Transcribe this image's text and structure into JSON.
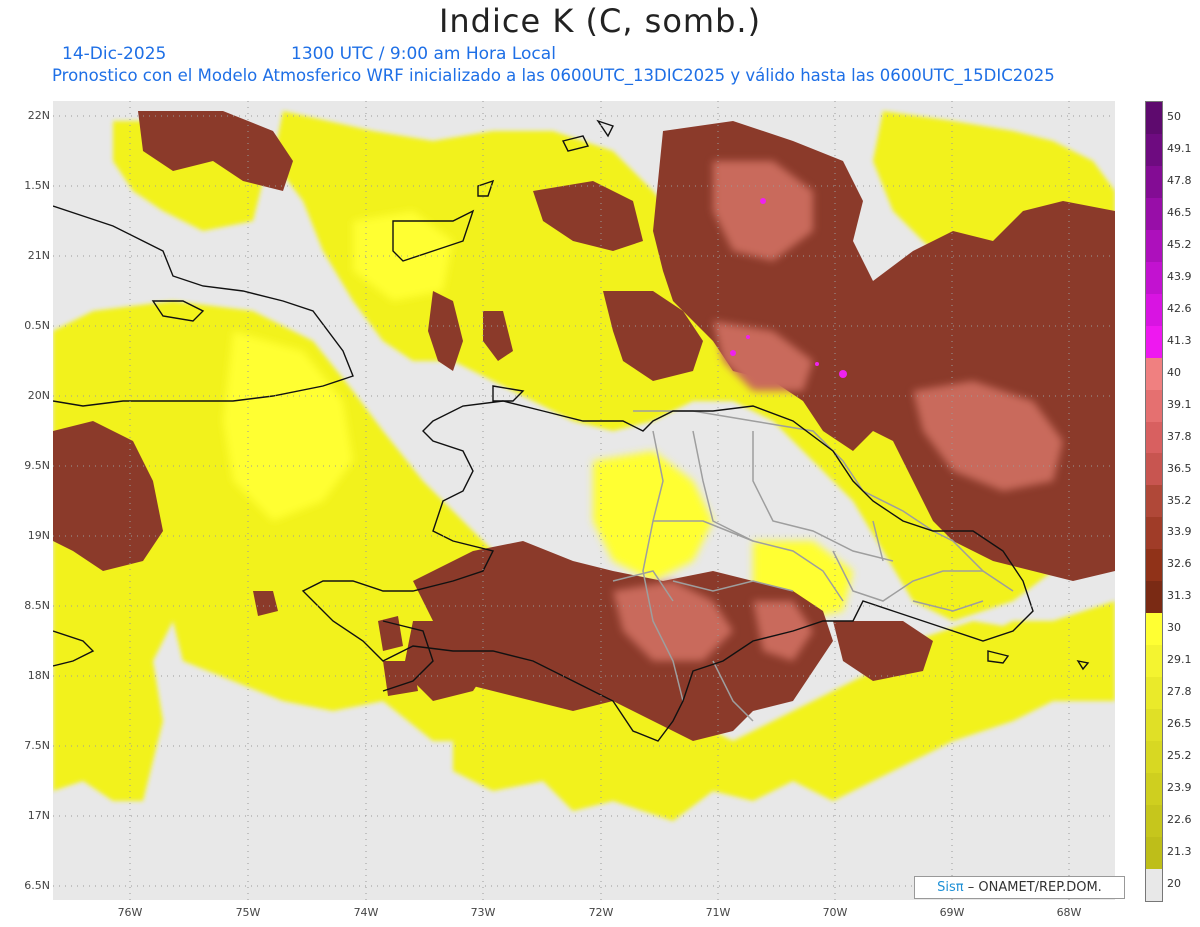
{
  "header": {
    "title": "Indice K (C, somb.)",
    "date": "14-Dic-2025",
    "time": "1300 UTC / 9:00 am Hora Local",
    "model_info": "Pronostico con el Modelo Atmosferico WRF inicializado a las 0600UTC_13DIC2025 y válido hasta las  0600UTC_15DIC2025"
  },
  "axes": {
    "lat_labels": [
      "22N",
      "1.5N",
      "21N",
      "0.5N",
      "20N",
      "9.5N",
      "19N",
      "8.5N",
      "18N",
      "7.5N",
      "17N",
      "6.5N"
    ],
    "lon_labels": [
      "76W",
      "75W",
      "74W",
      "73W",
      "72W",
      "71W",
      "70W",
      "69W",
      "68W"
    ]
  },
  "colorbar": {
    "labels": [
      "50",
      "49.1",
      "47.8",
      "46.5",
      "45.2",
      "43.9",
      "42.6",
      "41.3",
      "40",
      "39.1",
      "37.8",
      "36.5",
      "35.2",
      "33.9",
      "32.6",
      "31.3",
      "30",
      "29.1",
      "27.8",
      "26.5",
      "25.2",
      "23.9",
      "22.6",
      "21.3",
      "20"
    ],
    "colors": [
      "#5e0a6e",
      "#6e0b80",
      "#830c94",
      "#980ea8",
      "#ad10bc",
      "#c212d0",
      "#d814e2",
      "#ee18f0",
      "#f08080",
      "#e57070",
      "#d86060",
      "#c85550",
      "#b04838",
      "#a03c28",
      "#903218",
      "#7a2a14",
      "#ffff33",
      "#f4f430",
      "#eaea2a",
      "#e0e026",
      "#d8d822",
      "#cfcf1f",
      "#c6c61c",
      "#bebe19",
      "#e8e8e8"
    ]
  },
  "legend_colors": {
    "background": "#e8e8e8",
    "low_yellow": "#f2f21e",
    "bright_yellow": "#ffff33",
    "brown": "#8b3a2a",
    "rose": "#c96a5c",
    "magenta": "#ee22ee",
    "coast": "#111111",
    "borders": "#9e9e9e"
  },
  "credit": {
    "logo": "Sisπ",
    "text": "– ONAMET/REP.DOM."
  }
}
